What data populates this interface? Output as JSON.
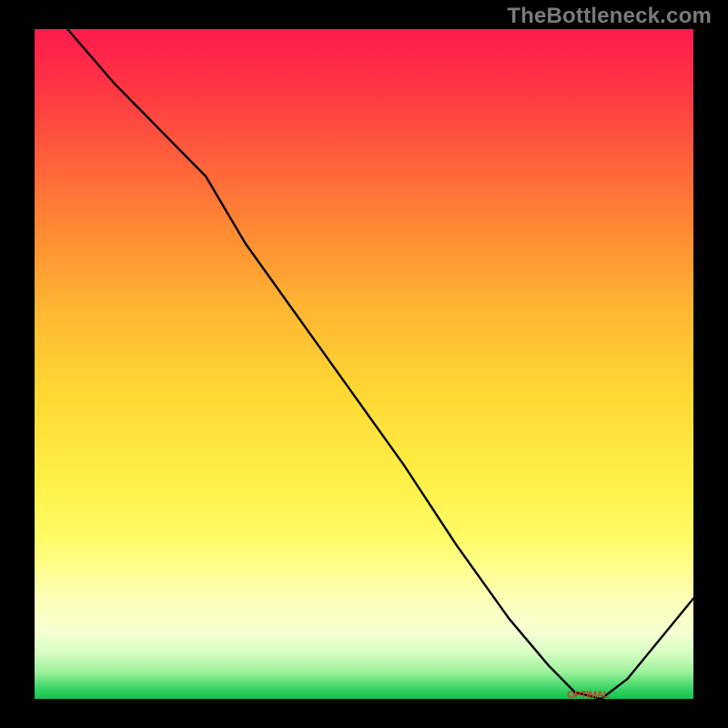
{
  "watermark": "TheBottleneck.com",
  "chart_data": {
    "type": "line",
    "title": "",
    "xlabel": "",
    "ylabel": "",
    "xlim": [
      0,
      100
    ],
    "ylim": [
      0,
      100
    ],
    "series": [
      {
        "name": "bottleneck-curve",
        "x": [
          5,
          12,
          20,
          26,
          32,
          40,
          48,
          56,
          64,
          72,
          78,
          82,
          86,
          90,
          100
        ],
        "values": [
          100,
          92,
          84,
          78,
          68,
          57,
          46,
          35,
          23,
          12,
          5,
          1,
          0,
          3,
          15
        ]
      }
    ],
    "annotations": [
      {
        "name": "optimal-marker",
        "x": 84,
        "y": 0.5,
        "text": "OPTIMAL"
      }
    ],
    "gradient_stops": [
      {
        "pos": 0,
        "color": "#ff1a4d"
      },
      {
        "pos": 0.18,
        "color": "#ff5a3d"
      },
      {
        "pos": 0.42,
        "color": "#ffb733"
      },
      {
        "pos": 0.66,
        "color": "#ffee44"
      },
      {
        "pos": 0.9,
        "color": "#f6ffd2"
      },
      {
        "pos": 1.0,
        "color": "#12c24f"
      }
    ]
  }
}
